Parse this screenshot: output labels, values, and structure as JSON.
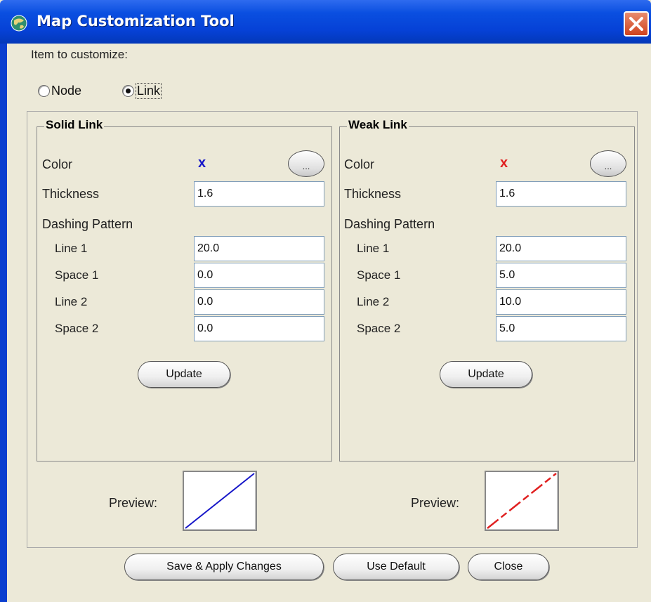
{
  "window": {
    "title": "Map Customization Tool",
    "close_icon": "close-icon",
    "app_icon": "globe-icon"
  },
  "item_section": {
    "label": "Item to customize:",
    "options": [
      {
        "label": "Node",
        "selected": false
      },
      {
        "label": "Link",
        "selected": true
      }
    ]
  },
  "panels": [
    {
      "title": "Solid Link",
      "color_label": "Color",
      "color_value_glyph": "x",
      "color_hex": "#1515C8",
      "color_button": "...",
      "thickness_label": "Thickness",
      "thickness_value": "1.6",
      "dash_label": "Dashing Pattern",
      "dash_rows": [
        {
          "label": "Line 1",
          "value": "20.0"
        },
        {
          "label": "Space 1",
          "value": "0.0"
        },
        {
          "label": "Line 2",
          "value": "0.0"
        },
        {
          "label": "Space 2",
          "value": "0.0"
        }
      ],
      "update_label": "Update",
      "preview_label": "Preview:"
    },
    {
      "title": "Weak Link",
      "color_label": "Color",
      "color_value_glyph": "x",
      "color_hex": "#E02020",
      "color_button": "...",
      "thickness_label": "Thickness",
      "thickness_value": "1.6",
      "dash_label": "Dashing Pattern",
      "dash_rows": [
        {
          "label": "Line 1",
          "value": "20.0"
        },
        {
          "label": "Space 1",
          "value": "5.0"
        },
        {
          "label": "Line 2",
          "value": "10.0"
        },
        {
          "label": "Space 2",
          "value": "5.0"
        }
      ],
      "update_label": "Update",
      "preview_label": "Preview:"
    }
  ],
  "footer": {
    "save_label": "Save & Apply Changes",
    "default_label": "Use Default",
    "close_label": "Close"
  },
  "colors": {
    "titlebar": "#0641D6",
    "background": "#ECE9D8"
  }
}
